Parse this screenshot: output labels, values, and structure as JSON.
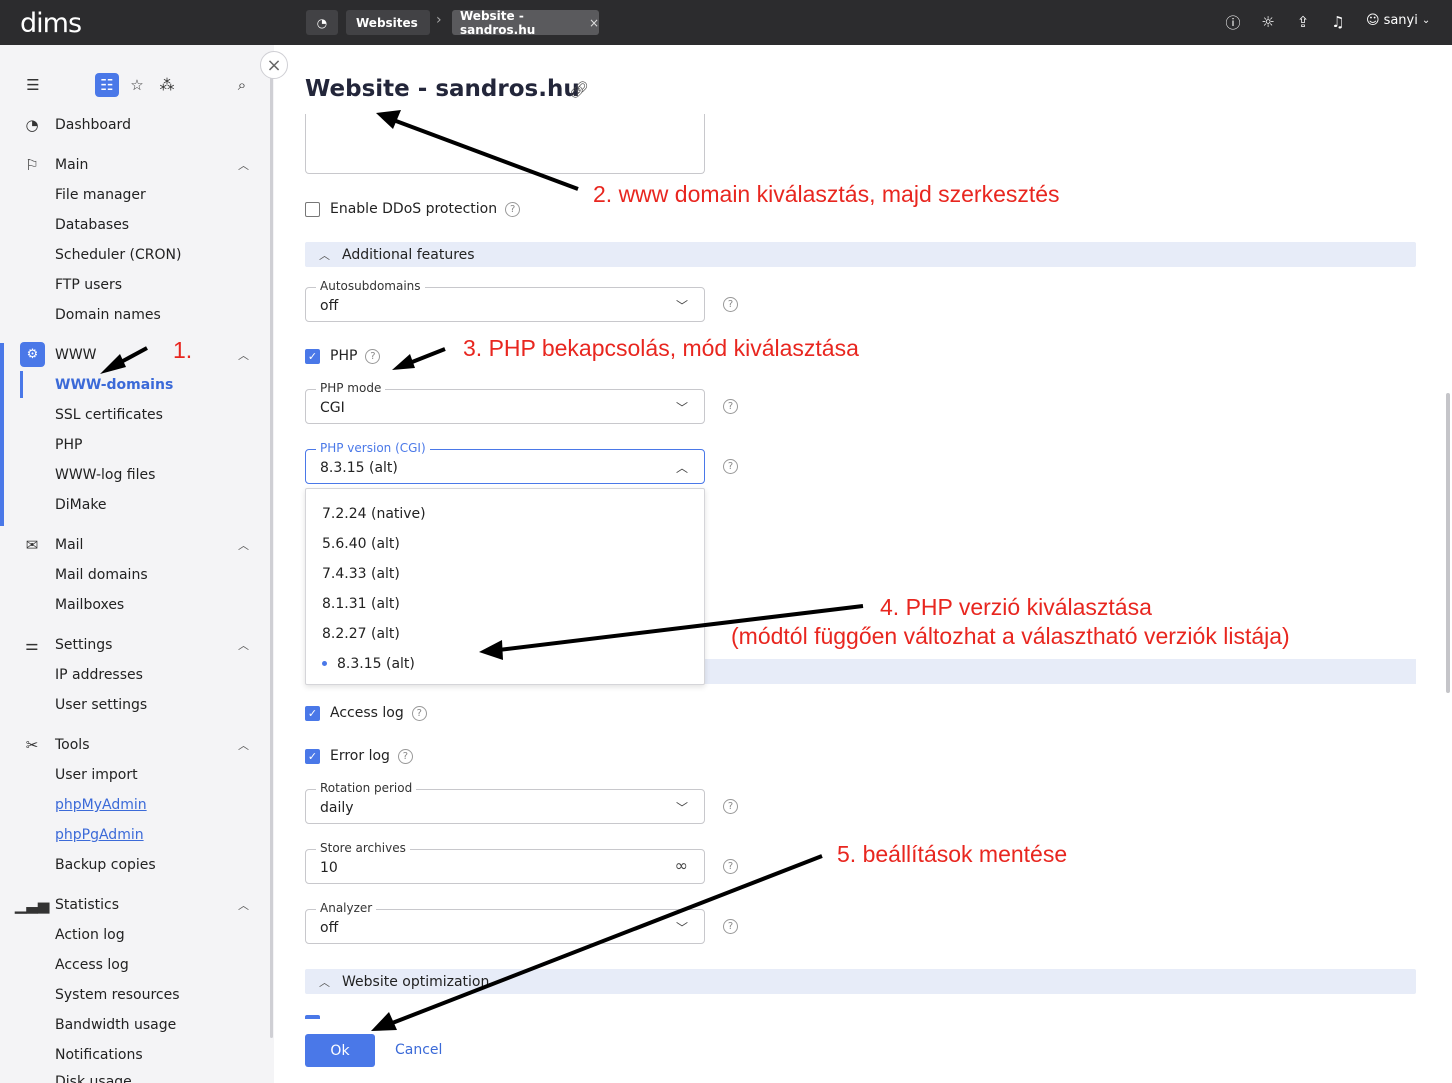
{
  "topbar": {
    "logo": "dims",
    "breadcrumb_parent": "Websites",
    "breadcrumb_separator": "›",
    "breadcrumb_current": "Website - sandros.hu",
    "close_glyph": "×",
    "user": "sanyi",
    "icons": [
      "dashboard-icon",
      "help-icon",
      "theme-sun-icon",
      "upload-icon",
      "bell-icon",
      "user-icon"
    ]
  },
  "sidebar": {
    "items": [
      {
        "label": "Dashboard"
      },
      {
        "label": "Main"
      },
      {
        "label": "File manager"
      },
      {
        "label": "Databases"
      },
      {
        "label": "Scheduler (CRON)"
      },
      {
        "label": "FTP users"
      },
      {
        "label": "Domain names"
      },
      {
        "label": "WWW"
      },
      {
        "label": "WWW-domains"
      },
      {
        "label": "SSL certificates"
      },
      {
        "label": "PHP"
      },
      {
        "label": "WWW-log files"
      },
      {
        "label": "DiMake"
      },
      {
        "label": "Mail"
      },
      {
        "label": "Mail domains"
      },
      {
        "label": "Mailboxes"
      },
      {
        "label": "Settings"
      },
      {
        "label": "IP addresses"
      },
      {
        "label": "User settings"
      },
      {
        "label": "Tools"
      },
      {
        "label": "User import"
      },
      {
        "label": "phpMyAdmin"
      },
      {
        "label": "phpPgAdmin"
      },
      {
        "label": "Backup copies"
      },
      {
        "label": "Statistics"
      },
      {
        "label": "Action log"
      },
      {
        "label": "Access log"
      },
      {
        "label": "System resources"
      },
      {
        "label": "Bandwidth usage"
      },
      {
        "label": "Notifications"
      },
      {
        "label": "Disk usage"
      }
    ]
  },
  "page": {
    "title": "Website - sandros.hu",
    "ddos_label": "Enable DDoS protection",
    "additional_features": "Additional features",
    "autosubdomains_label": "Autosubdomains",
    "autosubdomains_value": "off",
    "php_label": "PHP",
    "php_mode_label": "PHP mode",
    "php_mode_value": "CGI",
    "php_version_label": "PHP version (CGI)",
    "php_version_value": "8.3.15 (alt)",
    "php_versions": [
      "7.2.24 (native)",
      "5.6.40 (alt)",
      "7.4.33 (alt)",
      "8.1.31 (alt)",
      "8.2.27 (alt)",
      "8.3.15 (alt)"
    ],
    "access_log_label": "Access log",
    "error_log_label": "Error log",
    "rotation_period_label": "Rotation period",
    "rotation_period_value": "daily",
    "store_archives_label": "Store archives",
    "store_archives_value": "10",
    "analyzer_label": "Analyzer",
    "analyzer_value": "off",
    "website_optimization": "Website optimization",
    "ok_label": "Ok",
    "cancel_label": "Cancel"
  },
  "annotations": {
    "a1": "1.",
    "a2": "2. www domain kiválasztás, majd szerkesztés",
    "a3": "3. PHP bekapcsolás, mód kiválasztása",
    "a4_line1": "4. PHP verzió kiválasztása",
    "a4_line2": "(módtól függően változhat a választható verziók listája)",
    "a5": "5. beállítások mentése",
    "color": "#e8261f"
  },
  "colors": {
    "accent": "#4a78e8",
    "topbar": "#2c2c2e",
    "sidebar": "#f4f4f6",
    "section": "#e7ecf8"
  }
}
